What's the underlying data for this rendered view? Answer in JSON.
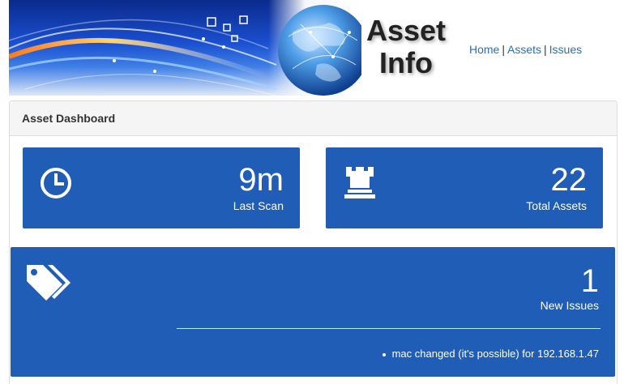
{
  "header": {
    "brand_line1": "Asset",
    "brand_line2": "Info",
    "nav": {
      "home": "Home",
      "assets": "Assets",
      "issues": "Issues",
      "separator": "|"
    }
  },
  "panel": {
    "title": "Asset Dashboard"
  },
  "stats": {
    "last_scan": {
      "value": "9m",
      "label": "Last Scan",
      "icon": "clock-icon"
    },
    "total_assets": {
      "value": "22",
      "label": "Total Assets",
      "icon": "rook-icon"
    },
    "new_issues": {
      "value": "1",
      "label": "New Issues",
      "icon": "tags-icon",
      "items": [
        "mac changed (it's possible) for 192.168.1.47"
      ]
    }
  },
  "colors": {
    "stat_background": "#1f5db7",
    "link": "#2a6ebb",
    "panel_heading_bg": "#f5f5f5"
  }
}
